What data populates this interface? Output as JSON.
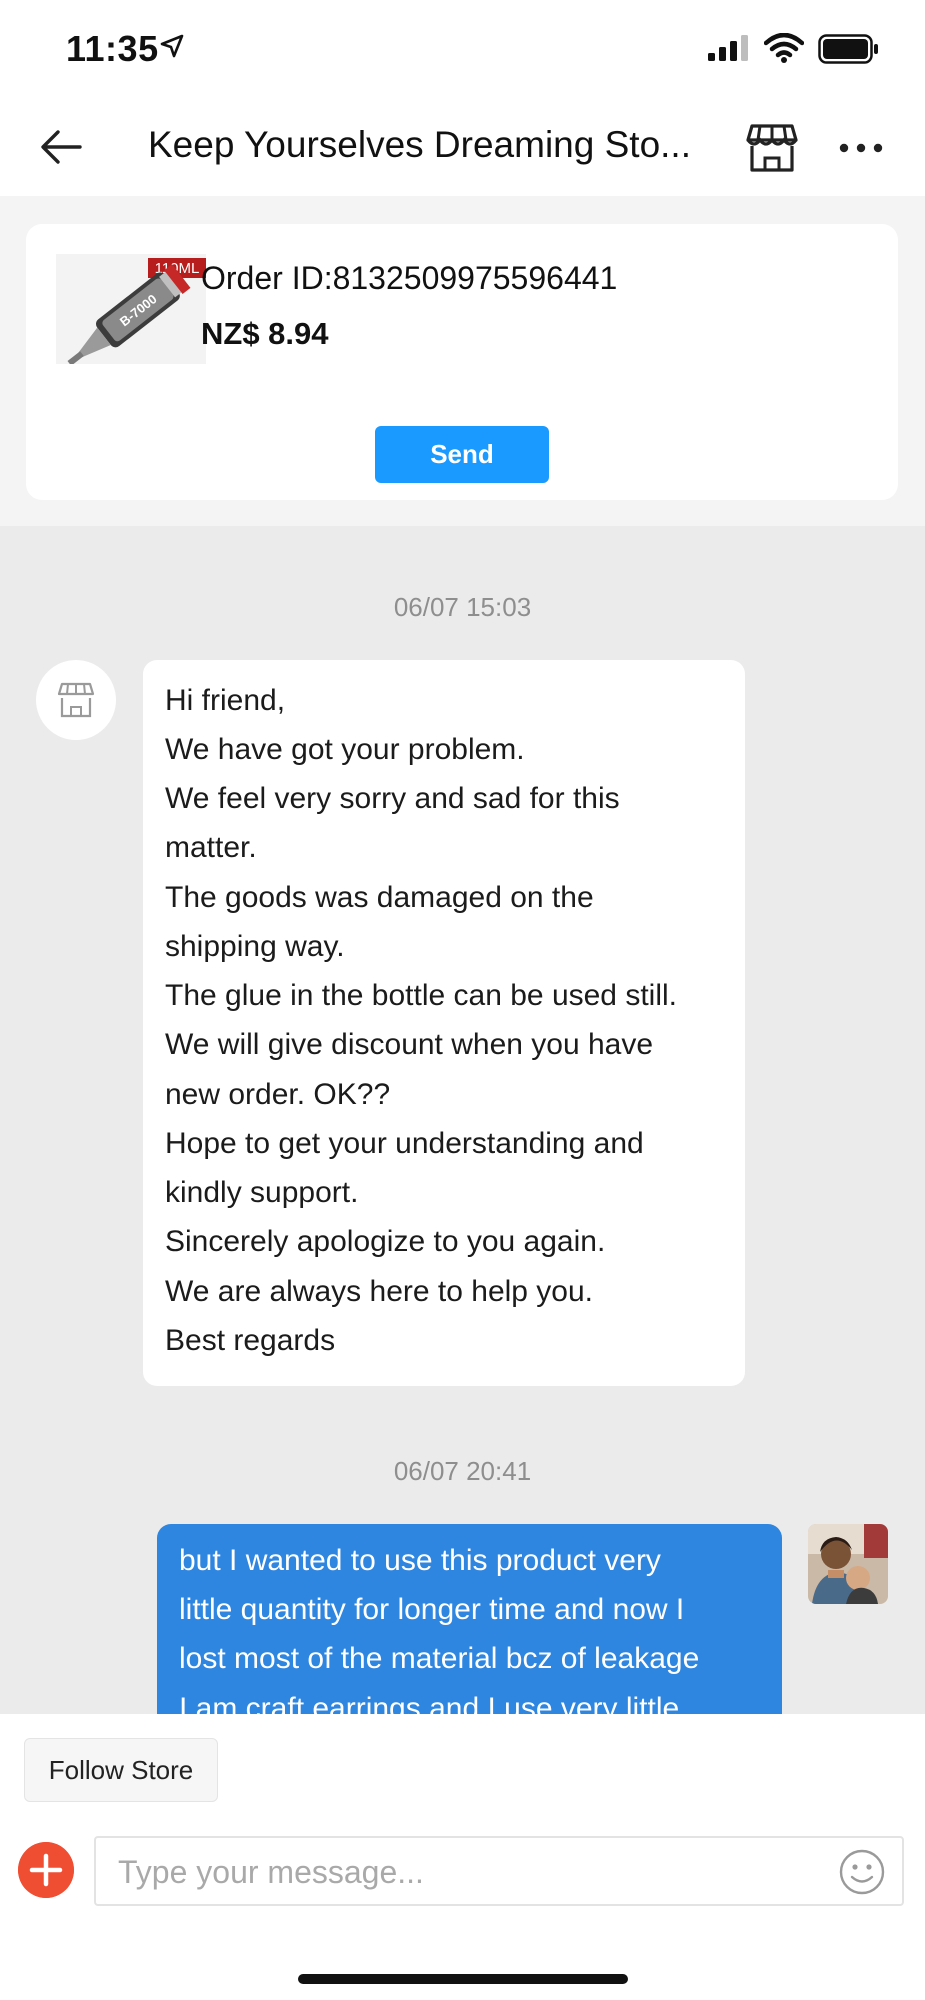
{
  "status_bar": {
    "time": "11:35"
  },
  "header": {
    "title": "Keep Yourselves Dreaming Sto..."
  },
  "order": {
    "product_badge": "110ML",
    "product_brand": "B-7000",
    "order_id": "Order ID:8132509975596441",
    "price": "NZ$ 8.94",
    "send_label": "Send"
  },
  "chat": {
    "timestamp_1": "06/07 15:03",
    "store_message_lines": [
      "Hi friend,",
      "We have got your problem.",
      "We feel very sorry and sad for this",
      "matter.",
      "The goods was damaged on the",
      "shipping way.",
      "The glue in the bottle can be used still.",
      "We will give discount when you have",
      "new order. OK??",
      "Hope to get your understanding and",
      "kindly support.",
      "Sincerely apologize to you again.",
      "We are always here to help you.",
      "Best regards"
    ],
    "timestamp_2": "06/07 20:41",
    "user_message_lines": [
      "but I wanted to use this product very",
      "little quantity for longer time and now I",
      "lost most of the material bcz of leakage",
      "I am craft earrings and I use very little"
    ]
  },
  "footer": {
    "follow_label": "Follow Store",
    "input_placeholder": "Type your message..."
  },
  "colors": {
    "accent_blue": "#1a9aff",
    "user_bubble": "#2e86e0",
    "plus_red": "#f04e32",
    "chat_background": "#ebebeb"
  },
  "icons": [
    "location-arrow-icon",
    "signal-icon",
    "wifi-icon",
    "battery-icon",
    "back-arrow-icon",
    "store-icon",
    "more-icon",
    "plus-icon",
    "emoji-icon"
  ]
}
